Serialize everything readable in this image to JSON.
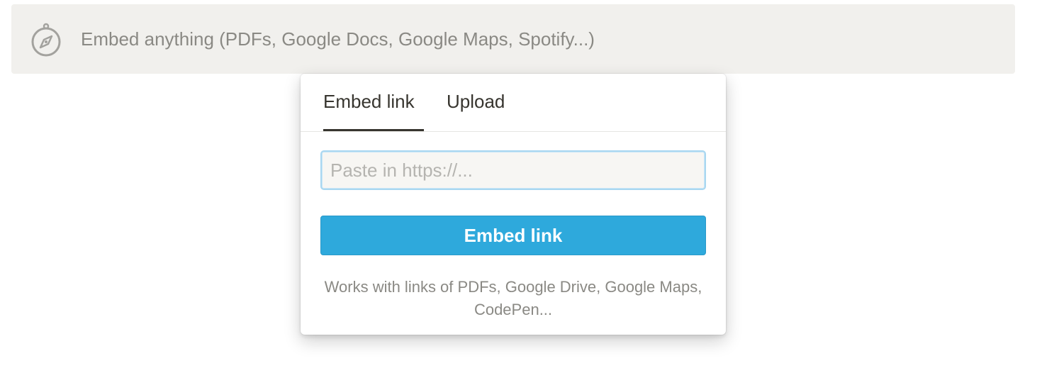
{
  "embed_block": {
    "icon": "compass-icon",
    "label": "Embed anything (PDFs, Google Docs, Google Maps, Spotify...)"
  },
  "popover": {
    "tabs": [
      {
        "label": "Embed link",
        "active": true
      },
      {
        "label": "Upload",
        "active": false
      }
    ],
    "input": {
      "value": "",
      "placeholder": "Paste in https://..."
    },
    "button_label": "Embed link",
    "helper_text": "Works with links of PDFs, Google Drive, Google Maps, CodePen..."
  },
  "colors": {
    "accent": "#2ea9dc",
    "block_background": "#f1f0ed",
    "text_primary": "#37352f",
    "text_secondary": "#8a8984"
  }
}
